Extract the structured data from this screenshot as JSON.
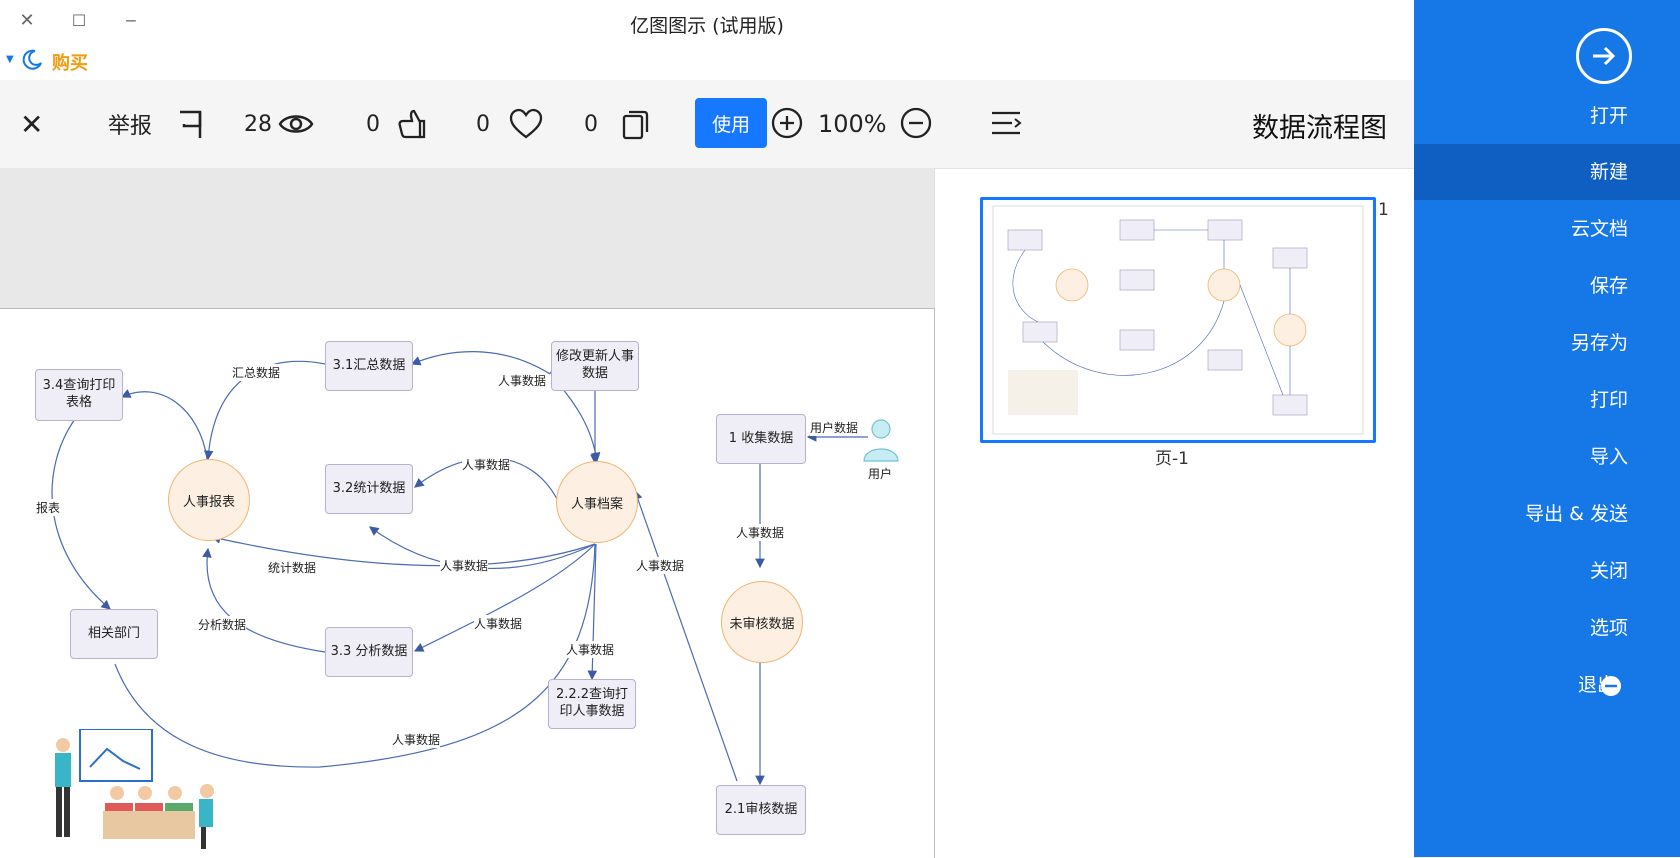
{
  "window": {
    "title": "亿图图示 (试用版)",
    "close_glyph": "✕",
    "max_glyph": "☐",
    "min_glyph": "‒"
  },
  "buy": {
    "label": "购买"
  },
  "toolbar": {
    "close_glyph": "✕",
    "report_label": "举报",
    "views_count": "28",
    "likes_count": "0",
    "favorites_count": "0",
    "copies_count": "0",
    "use_label": "使用",
    "zoom_level": "100%",
    "doc_title": "数据流程图"
  },
  "sidebar": {
    "items": [
      {
        "label": "打开"
      },
      {
        "label": "新建"
      },
      {
        "label": "云文档"
      },
      {
        "label": "保存"
      },
      {
        "label": "另存为"
      },
      {
        "label": "打印"
      },
      {
        "label": "导入"
      },
      {
        "label": "导出 & 发送"
      },
      {
        "label": "关闭"
      },
      {
        "label": "选项"
      },
      {
        "label": "退出"
      }
    ],
    "accent": "#1677e6",
    "active_bg": "#0f5fc2"
  },
  "pages": {
    "number": "1",
    "caption": "页-1"
  },
  "diagram": {
    "nodes": {
      "n_34": "3.4查询打印表格",
      "n_31": "3.1汇总数据",
      "n_update": "修改更新人事数据",
      "n_32": "3.2统计数据",
      "n_33": "3.3 分析数据",
      "n_222": "2.2.2查询打印人事数据",
      "n_1": "1 收集数据",
      "n_21": "2.1审核数据",
      "n_dept": "相关部门",
      "c_report": "人事报表",
      "c_archive": "人事档案",
      "c_unreviewed": "未审核数据",
      "user": "用户"
    },
    "edges": {
      "e_summary": "汇总数据",
      "e_hr1": "人事数据",
      "e_hr2": "人事数据",
      "e_stat": "统计数据",
      "e_hr3": "人事数据",
      "e_analysis": "分析数据",
      "e_hr4": "人事数据",
      "e_hr5": "人事数据",
      "e_hr6": "人事数据",
      "e_hr7": "人事数据",
      "e_report": "报表",
      "e_user": "用户数据",
      "e_hr8": "人事数据"
    }
  }
}
